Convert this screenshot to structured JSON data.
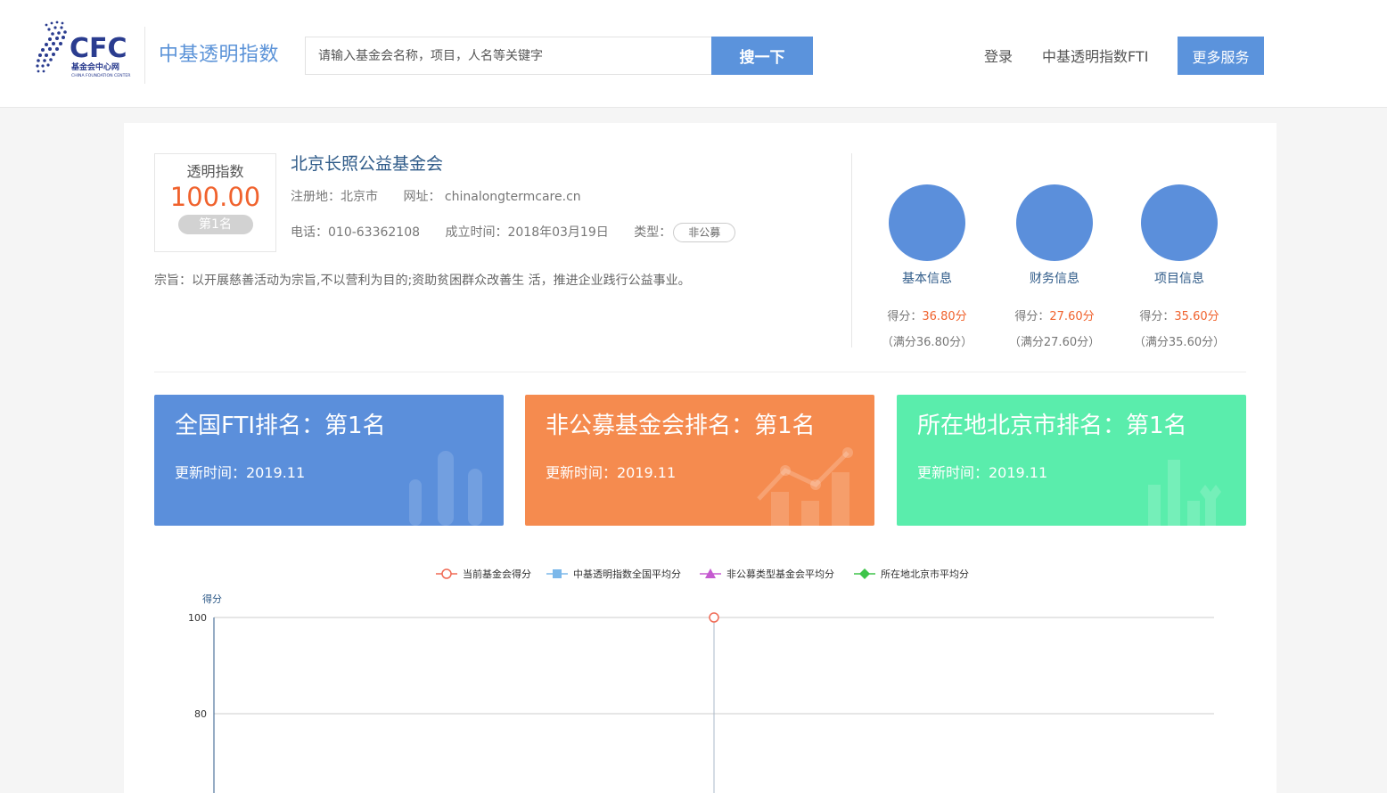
{
  "header": {
    "logo_text": "CFC",
    "logo_sub": "基金会中心网",
    "logo_en": "CHINA FOUNDATION CENTER",
    "brand": "中基透明指数",
    "search_placeholder": "请输入基金会名称，项目，人名等关键字",
    "search_button": "搜一下",
    "login": "登录",
    "fti_link": "中基透明指数FTI",
    "more_services": "更多服务"
  },
  "org": {
    "score_title": "透明指数",
    "score_value": "100.00",
    "rank_badge": "第1名",
    "name": "北京长照公益基金会",
    "registered": "注册地：北京市",
    "website": "网址： chinalongtermcare.cn",
    "phone": "电话：010-63362108",
    "founded": "成立时间：2018年03月19日",
    "type_label": "类型：",
    "type_value": "非公募",
    "mission": "宗旨：以开展慈善活动为宗旨,不以营利为目的;资助贫困群众改善生 活，推进企业践行公益事业。"
  },
  "categories": [
    {
      "label": "基本信息",
      "score_prefix": "得分：",
      "score": "36.80分",
      "full": "（满分36.80分）"
    },
    {
      "label": "财务信息",
      "score_prefix": "得分：",
      "score": "27.60分",
      "full": "（满分27.60分）"
    },
    {
      "label": "项目信息",
      "score_prefix": "得分：",
      "score": "35.60分",
      "full": "（满分35.60分）"
    }
  ],
  "rank_cards": [
    {
      "title": "全国FTI排名：第1名",
      "update": "更新时间：2019.11",
      "color": "#5b8fdb"
    },
    {
      "title": "非公募基金会排名：第1名",
      "update": "更新时间：2019.11",
      "color": "#f58b4f"
    },
    {
      "title": "所在地北京市排名：第1名",
      "update": "更新时间：2019.11",
      "color": "#5aedac"
    }
  ],
  "chart_data": {
    "type": "line",
    "ylabel": "得分",
    "yticks": [
      100,
      80
    ],
    "ylim_visible": [
      70,
      100
    ],
    "series": [
      {
        "name": "当前基金会得分",
        "color": "#f06a55",
        "marker": "circle",
        "values": [
          100
        ]
      },
      {
        "name": "中基透明指数全国平均分",
        "color": "#7cb8ea",
        "marker": "square",
        "values": []
      },
      {
        "name": "非公募类型基金会平均分",
        "color": "#c55ad0",
        "marker": "triangle",
        "values": []
      },
      {
        "name": "所在地北京市平均分",
        "color": "#3ec44a",
        "marker": "diamond",
        "values": []
      }
    ]
  }
}
